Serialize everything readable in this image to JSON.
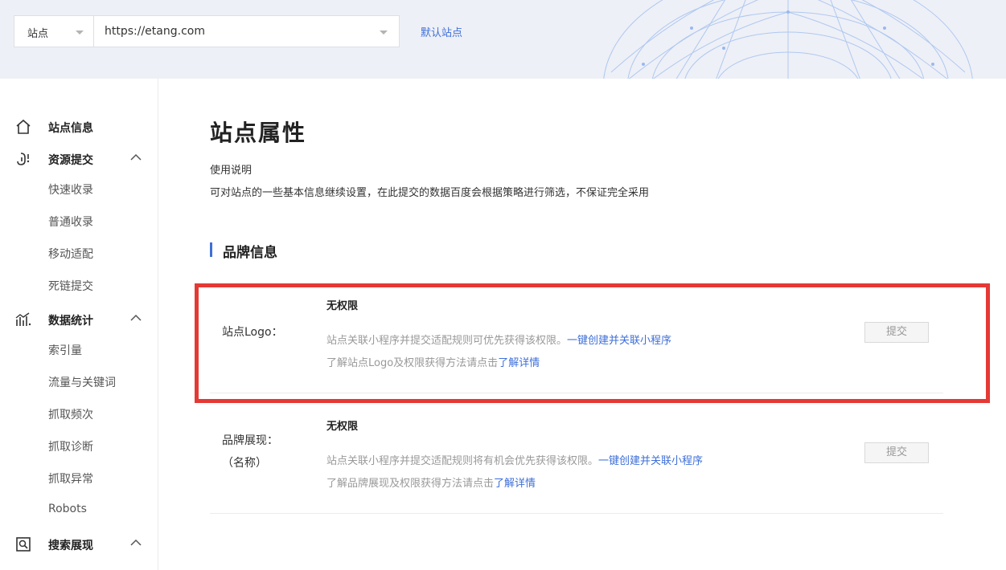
{
  "header": {
    "site_label": "站点",
    "site_url": "https://etang.com",
    "default_site_link": "默认站点"
  },
  "sidebar": {
    "groups": [
      {
        "label": "站点信息",
        "icon": "home-icon"
      },
      {
        "label": "资源提交",
        "icon": "link-submit-icon",
        "expanded": true,
        "items": [
          "快速收录",
          "普通收录",
          "移动适配",
          "死链提交"
        ]
      },
      {
        "label": "数据统计",
        "icon": "chart-icon",
        "expanded": true,
        "items": [
          "索引量",
          "流量与关键词",
          "抓取频次",
          "抓取诊断",
          "抓取异常",
          "Robots"
        ]
      },
      {
        "label": "搜索展现",
        "icon": "search-display-icon",
        "expanded": true
      }
    ]
  },
  "main": {
    "title": "站点属性",
    "usage_label": "使用说明",
    "usage_desc": "可对站点的一些基本信息继续设置，在此提交的数据百度会根据策略进行筛选，不保证完全采用",
    "section_title": "品牌信息",
    "rows": [
      {
        "name": "站点Logo：",
        "permission": "无权限",
        "line1_text": "站点关联小程序并提交适配规则可优先获得该权限。",
        "line1_link": "一键创建并关联小程序",
        "line2_text": "了解站点Logo及权限获得方法请点击",
        "line2_link": "了解详情",
        "button": "提交"
      },
      {
        "name_line1": "品牌展现：",
        "name_line2": "（名称）",
        "permission": "无权限",
        "line1_text": "站点关联小程序并提交适配规则将有机会优先获得该权限。",
        "line1_link": "一键创建并关联小程序",
        "line2_text": "了解品牌展现及权限获得方法请点击",
        "line2_link": "了解详情",
        "button": "提交"
      }
    ]
  },
  "colors": {
    "accent": "#3e6fd8",
    "highlight": "#e53935",
    "header_bg": "#eef0f7"
  }
}
